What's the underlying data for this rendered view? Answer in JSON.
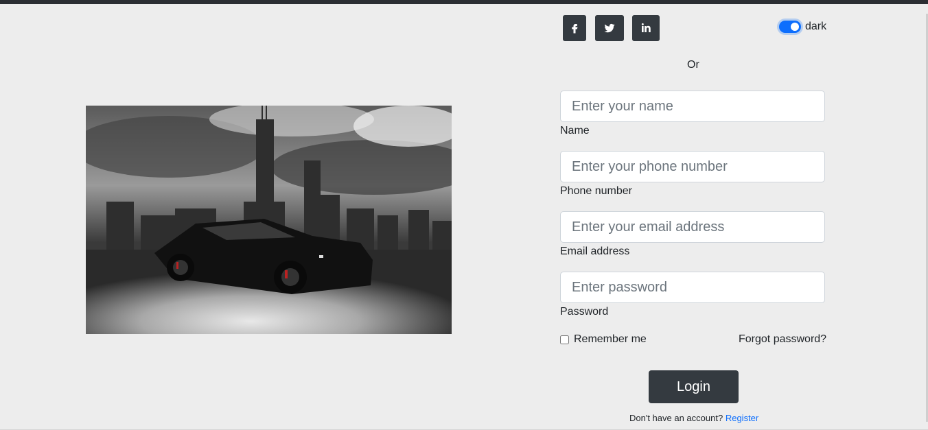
{
  "social": {
    "facebook_icon": "facebook-icon",
    "twitter_icon": "twitter-icon",
    "linkedin_icon": "linkedin-icon"
  },
  "theme_toggle": {
    "label": "dark",
    "checked": true,
    "accent": "#0d6efd"
  },
  "divider_text": "Or",
  "form": {
    "name": {
      "placeholder": "Enter your name",
      "label": "Name"
    },
    "phone": {
      "placeholder": "Enter your phone number",
      "label": "Phone number"
    },
    "email": {
      "placeholder": "Enter your email address",
      "label": "Email address"
    },
    "password": {
      "placeholder": "Enter password",
      "label": "Password"
    },
    "remember_label": "Remember me",
    "forgot_label": "Forgot password?",
    "login_label": "Login",
    "register_prompt": "Don't have an account?",
    "register_link": "Register"
  },
  "colors": {
    "background": "#ededed",
    "button": "#343a40",
    "link": "#0d6efd"
  }
}
